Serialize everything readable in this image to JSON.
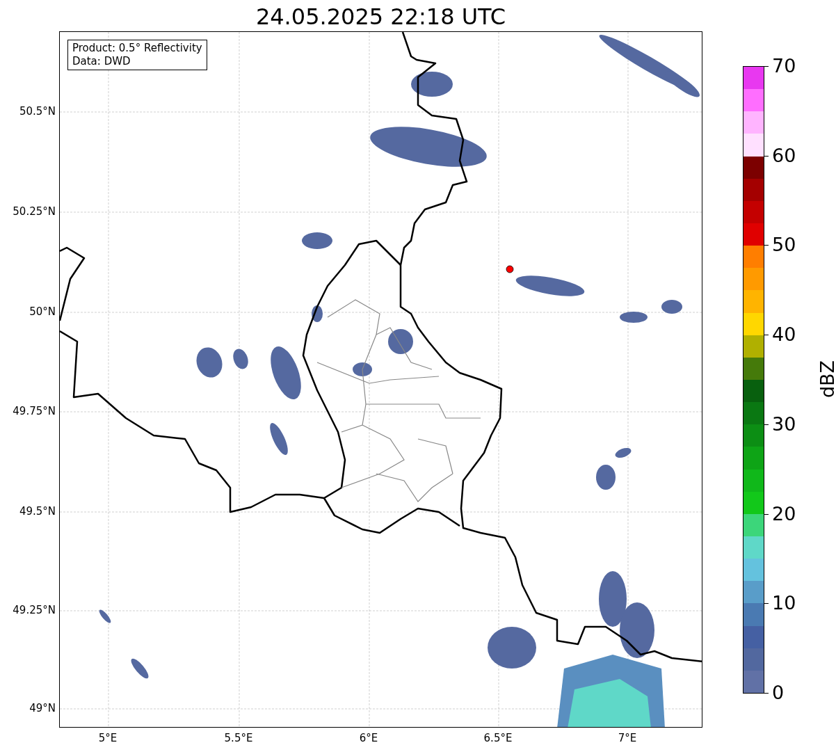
{
  "title": "24.05.2025 22:18 UTC",
  "info_box": [
    "Product: 0.5° Reflectivity",
    "Data: DWD"
  ],
  "map": {
    "lat_ticks": [
      "50.5°N",
      "50.25°N",
      "50°N",
      "49.75°N",
      "49.5°N",
      "49.25°N",
      "49°N"
    ],
    "lon_ticks": [
      "5°E",
      "5.5°E",
      "6°E",
      "6.5°E",
      "7°E"
    ]
  },
  "colorbar": {
    "label": "dBZ",
    "ticks": [
      "70",
      "60",
      "50",
      "40",
      "30",
      "20",
      "10",
      "0"
    ],
    "bins": [
      {
        "color": "#e838f0"
      },
      {
        "color": "#ff6eff"
      },
      {
        "color": "#ffb4ff"
      },
      {
        "color": "#ffe0ff"
      },
      {
        "color": "#7c0000"
      },
      {
        "color": "#a40000"
      },
      {
        "color": "#c40000"
      },
      {
        "color": "#e00000"
      },
      {
        "color": "#ff7e00"
      },
      {
        "color": "#ff9a00"
      },
      {
        "color": "#ffb400"
      },
      {
        "color": "#ffd700"
      },
      {
        "color": "#b0b000"
      },
      {
        "color": "#457a0a"
      },
      {
        "color": "#08600e"
      },
      {
        "color": "#0a7812"
      },
      {
        "color": "#0c8e14"
      },
      {
        "color": "#0ea416"
      },
      {
        "color": "#10b81a"
      },
      {
        "color": "#12c81a"
      },
      {
        "color": "#3cd67a"
      },
      {
        "color": "#5fd8c8"
      },
      {
        "color": "#64c2de"
      },
      {
        "color": "#599dc9"
      },
      {
        "color": "#4a7ab2"
      },
      {
        "color": "#4560a3"
      },
      {
        "color": "#52689f"
      },
      {
        "color": "#6171a6"
      }
    ]
  }
}
